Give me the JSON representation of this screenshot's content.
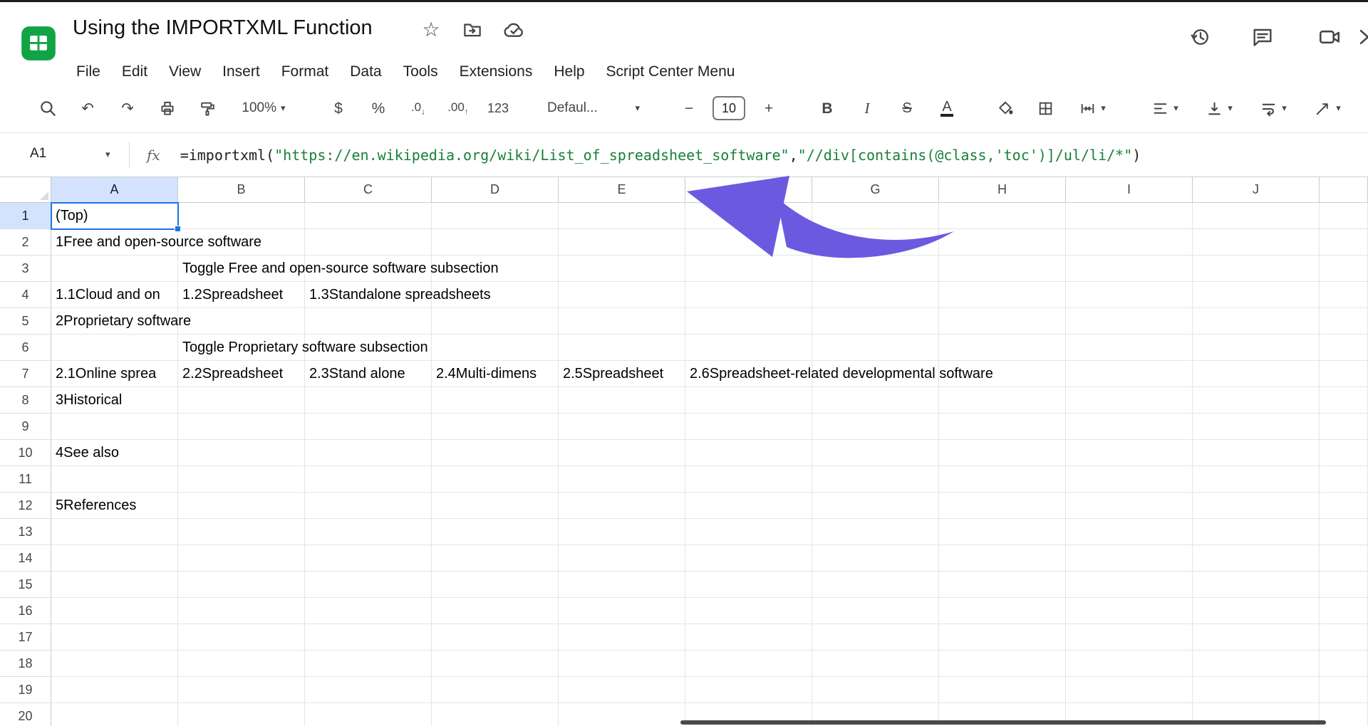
{
  "colors": {
    "logo_green": "#12A347",
    "selection_blue": "#1A73E8",
    "header_highlight": "#D3E3FD",
    "formula_string_green": "#188038",
    "arrow_purple": "#6B5AE0"
  },
  "titlebar": {
    "title": "Using the IMPORTXML Function",
    "menus": [
      "File",
      "Edit",
      "View",
      "Insert",
      "Format",
      "Data",
      "Tools",
      "Extensions",
      "Help",
      "Script Center Menu"
    ]
  },
  "toolbar": {
    "zoom_value": "100%",
    "currency_label": "$",
    "percent_label": "%",
    "decimal_decrease_label": ".0",
    "decimal_decrease_arrow": "↓",
    "decimal_increase_label": ".00",
    "decimal_increase_arrow": "↑",
    "number_format_label": "123",
    "font_name_value": "Defaul...",
    "font_size_value": "10",
    "decrease_font_label": "−",
    "increase_font_label": "+",
    "bold_label": "B",
    "italic_label": "I",
    "strikethrough_label": "S",
    "text_color_label": "A",
    "undo_glyph": "↶",
    "redo_glyph": "↷",
    "more_glyph": "⋮",
    "chevron_glyph": "▾",
    "star_glyph": "☆"
  },
  "formula_bar": {
    "name_box_value": "A1",
    "fx_label": "fx",
    "formula": {
      "prefix": "=importxml(",
      "arg1": "\"https://en.wikipedia.org/wiki/List_of_spreadsheet_software\"",
      "separator": ",",
      "arg2": "\"//div[contains(@class,'toc')]/ul/li/*\"",
      "suffix": ")"
    }
  },
  "grid": {
    "column_headers": [
      "A",
      "B",
      "C",
      "D",
      "E",
      "F",
      "G",
      "H",
      "I",
      "J",
      ""
    ],
    "row_count": 20,
    "selected_cell": {
      "ref": "A1",
      "column": "A",
      "row": 1
    },
    "cells": [
      {
        "ref": "A1",
        "text": "(Top)",
        "clip": false
      },
      {
        "ref": "A2",
        "text": "1Free and open-source software",
        "clip": false
      },
      {
        "ref": "B3",
        "text": "Toggle Free and open-source software subsection",
        "clip": false
      },
      {
        "ref": "A4",
        "text": "1.1Cloud and on",
        "clip": true
      },
      {
        "ref": "B4",
        "text": "1.2Spreadsheet",
        "clip": true
      },
      {
        "ref": "C4",
        "text": "1.3Standalone spreadsheets",
        "clip": false
      },
      {
        "ref": "A5",
        "text": "2Proprietary software",
        "clip": false
      },
      {
        "ref": "B6",
        "text": "Toggle Proprietary software subsection",
        "clip": false
      },
      {
        "ref": "A7",
        "text": "2.1Online sprea",
        "clip": true
      },
      {
        "ref": "B7",
        "text": "2.2Spreadsheet",
        "clip": true
      },
      {
        "ref": "C7",
        "text": "2.3Stand alone",
        "clip": true
      },
      {
        "ref": "D7",
        "text": "2.4Multi-dimens",
        "clip": true
      },
      {
        "ref": "E7",
        "text": "2.5Spreadsheet",
        "clip": true
      },
      {
        "ref": "F7",
        "text": "2.6Spreadsheet-related developmental software",
        "clip": false
      },
      {
        "ref": "A8",
        "text": "3Historical",
        "clip": false
      },
      {
        "ref": "A10",
        "text": "4See also",
        "clip": false
      },
      {
        "ref": "A12",
        "text": "5References",
        "clip": false
      }
    ]
  }
}
